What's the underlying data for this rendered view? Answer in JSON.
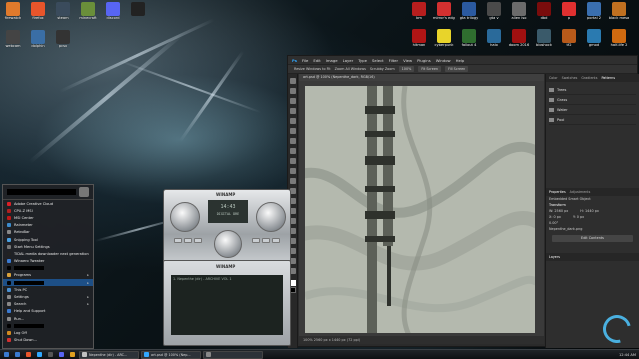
{
  "desktop_icons_left": [
    {
      "label": "firewatch",
      "color": "#e07a2c"
    },
    {
      "label": "firefox",
      "color": "#e8552b"
    },
    {
      "label": "steam",
      "color": "#3a4b5c"
    },
    {
      "label": "minecraft",
      "color": "#6a8f3a"
    },
    {
      "label": "discord",
      "color": "#5865f2"
    },
    {
      "label": "",
      "color": "#222222"
    }
  ],
  "desktop_icons_left2": [
    {
      "label": "webcam",
      "color": "#444444"
    },
    {
      "label": "dolphin",
      "color": "#3a6ea5"
    },
    {
      "label": "pcsx",
      "color": "#333333"
    }
  ],
  "desktop_icons_right_row1": [
    {
      "label": "bm",
      "color": "#b81e1e"
    },
    {
      "label": "mirror's edge",
      "color": "#d33030"
    },
    {
      "label": "gta trilogy",
      "color": "#2b5aa0"
    },
    {
      "label": "gta v",
      "color": "#4a4a4a"
    },
    {
      "label": "alien iso",
      "color": "#6b6b6b"
    },
    {
      "label": "dbd",
      "color": "#7a0c0c"
    },
    {
      "label": "p",
      "color": "#e03030"
    },
    {
      "label": "portal 2",
      "color": "#3a6fb0"
    },
    {
      "label": "black mesa",
      "color": "#c07020"
    }
  ],
  "desktop_icons_right_row2": [
    {
      "label": "hitman",
      "color": "#b01515"
    },
    {
      "label": "cyberpunk",
      "color": "#e8d42a"
    },
    {
      "label": "fallout 4",
      "color": "#2f6e2f"
    },
    {
      "label": "halo",
      "color": "#2a6a9a"
    },
    {
      "label": "doom 2016",
      "color": "#a01010"
    },
    {
      "label": "bioshock",
      "color": "#3a5a6a"
    },
    {
      "label": "tf2",
      "color": "#b85a1a"
    },
    {
      "label": "gmod",
      "color": "#2a7ab0"
    },
    {
      "label": "half-life 2",
      "color": "#d06a10"
    }
  ],
  "photoshop": {
    "menu": [
      "Ps",
      "File",
      "Edit",
      "Image",
      "Layer",
      "Type",
      "Select",
      "Filter",
      "View",
      "Plugins",
      "Window",
      "Help"
    ],
    "options": [
      "Resize Windows to Fit",
      "Zoom All Windows",
      "Scrubby Zoom",
      "100%",
      "Fit Screen",
      "Fill Screen"
    ],
    "doc_tab": "art.psd @ 100% (Nepenthe_dark, RGB/16)",
    "status": "100%   2560 px x 1440 px (72 ppi)",
    "panel_tabs": [
      "Color",
      "Swatches",
      "Gradients",
      "Patterns"
    ],
    "patterns": [
      "Trees",
      "Grass",
      "Water",
      "Pool"
    ],
    "props_tabs": [
      "Properties",
      "Adjustments"
    ],
    "props": {
      "title": "Embedded Smart Object",
      "transform": "Transform",
      "w": "W: 2560 px",
      "h": "H: 1440 px",
      "x": "X: 0 px",
      "y": "Y: 0 px",
      "angle": "0.00°",
      "file": "Nepenthe_dark.png",
      "edit_btn": "Edit Contents"
    },
    "layers_tab": "Layers"
  },
  "winamp": {
    "brand": "WINAMP",
    "time": "14:43",
    "track": "DIGITAL  DRE"
  },
  "playlist": {
    "brand": "WINAMP",
    "line": "1. Nepenthe (dir) - ARCHIVE VOL 1"
  },
  "startmenu": {
    "items": [
      {
        "label": "Adobe Creative Cloud",
        "color": "#da1f26",
        "arrow": ""
      },
      {
        "label": "CPU-Z MSI",
        "color": "#b02020",
        "arrow": ""
      },
      {
        "label": "MSI Center",
        "color": "#c01818",
        "arrow": ""
      },
      {
        "label": "Rainmeter",
        "color": "#3c8ccc",
        "arrow": ""
      },
      {
        "label": "RetroBar",
        "color": "#888888",
        "arrow": ""
      },
      {
        "label": "Snipping Tool",
        "color": "#4aa0e0",
        "arrow": ""
      },
      {
        "label": "Start Menu Settings",
        "color": "#777777",
        "arrow": ""
      },
      {
        "label": "TIDAL media downloader next generation",
        "color": "#222222",
        "arrow": ""
      },
      {
        "label": "Winaero Tweaker",
        "color": "#3a7ad0",
        "arrow": ""
      },
      {
        "label": "",
        "color": "#000000",
        "arrow": ""
      },
      {
        "label": "Programs",
        "color": "#d9a13a",
        "arrow": "▸"
      },
      {
        "label": "",
        "color": "#000000",
        "arrow": "▸"
      },
      {
        "label": "This PC",
        "color": "#4a90d0",
        "arrow": ""
      },
      {
        "label": "Settings",
        "color": "#888888",
        "arrow": "▸"
      },
      {
        "label": "Search",
        "color": "#888888",
        "arrow": "▸"
      },
      {
        "label": "Help and Support",
        "color": "#3a7ad0",
        "arrow": ""
      },
      {
        "label": "Run...",
        "color": "#888888",
        "arrow": ""
      },
      {
        "label": "",
        "color": "#000000",
        "arrow": ""
      },
      {
        "label": "Log Off",
        "color": "#d08a20",
        "arrow": ""
      },
      {
        "label": "Shut Down...",
        "color": "#d03030",
        "arrow": ""
      }
    ]
  },
  "taskbar": {
    "items": [
      {
        "label": "",
        "color": "#3a7ad0"
      },
      {
        "label": "",
        "color": "#e8552b"
      },
      {
        "label": "",
        "color": "#31a8ff"
      },
      {
        "label": "",
        "color": "#555555"
      },
      {
        "label": "",
        "color": "#5865f2"
      },
      {
        "label": "",
        "color": "#e0a020"
      }
    ],
    "buttons": [
      {
        "label": "Nepenthe (dir) - ARC...",
        "color": "#c0c0c0"
      },
      {
        "label": "art.psd @ 100% (Nep...",
        "color": "#31a8ff"
      },
      {
        "label": "",
        "color": "#888888"
      }
    ],
    "clock": "12:44 AM"
  }
}
